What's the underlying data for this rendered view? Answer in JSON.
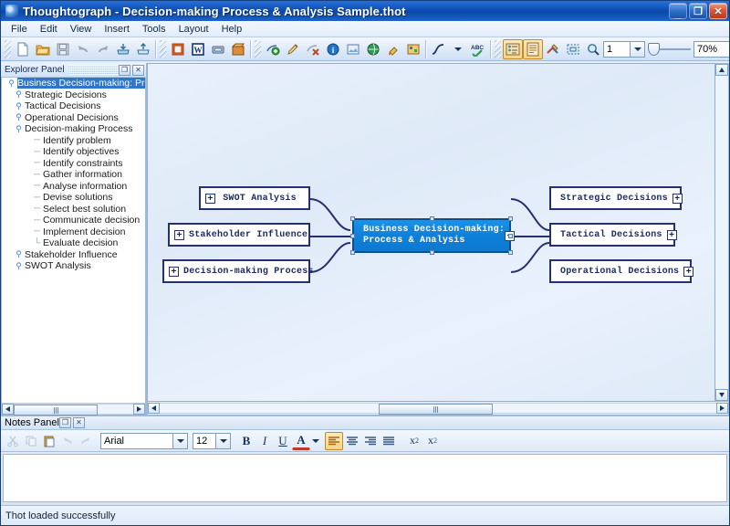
{
  "window": {
    "title": "Thoughtograph - Decision-making Process & Analysis Sample.thot",
    "app_icon": "thoughtograph-logo-icon",
    "minimize_label": "_",
    "maximize_label": "❐",
    "close_label": "✕"
  },
  "menu": {
    "items": [
      {
        "label": "File"
      },
      {
        "label": "Edit"
      },
      {
        "label": "View"
      },
      {
        "label": "Insert"
      },
      {
        "label": "Tools"
      },
      {
        "label": "Layout"
      },
      {
        "label": "Help"
      }
    ]
  },
  "toolbar": {
    "groups": [
      {
        "buttons": [
          {
            "name": "new-document-icon",
            "title": "New"
          },
          {
            "name": "open-folder-icon",
            "title": "Open"
          },
          {
            "name": "save-disk-icon",
            "title": "Save"
          },
          {
            "name": "undo-arrow-icon",
            "title": "Undo"
          },
          {
            "name": "redo-arrow-icon",
            "title": "Redo"
          },
          {
            "name": "import-tray-icon",
            "title": "Import"
          },
          {
            "name": "export-tray-icon",
            "title": "Export"
          }
        ]
      },
      {
        "buttons": [
          {
            "name": "export-powerpoint-icon",
            "title": "Export to PowerPoint"
          },
          {
            "name": "export-word-icon",
            "title": "Export to Word"
          },
          {
            "name": "export-html-icon",
            "title": "Export to HTML"
          },
          {
            "name": "export-package-icon",
            "title": "Export package"
          }
        ]
      },
      {
        "buttons": [
          {
            "name": "add-node-icon",
            "title": "Add node"
          },
          {
            "name": "edit-node-icon",
            "title": "Edit node"
          },
          {
            "name": "delete-node-icon",
            "title": "Delete node"
          },
          {
            "name": "node-info-icon",
            "title": "Node information"
          },
          {
            "name": "insert-image-icon",
            "title": "Insert image"
          },
          {
            "name": "insert-link-icon",
            "title": "Insert link"
          },
          {
            "name": "paint-fill-icon",
            "title": "Fill colour"
          },
          {
            "name": "node-properties-icon",
            "title": "Node properties"
          }
        ]
      },
      {
        "buttons": [
          {
            "name": "curve-style-icon",
            "title": "Connector style"
          },
          {
            "name": "curve-style-dropdown-icon",
            "title": "Connector style options"
          },
          {
            "name": "spell-check-icon",
            "title": "Spell check"
          }
        ]
      },
      {
        "buttons": [
          {
            "name": "explorer-panel-toggle-icon",
            "title": "Explorer Panel",
            "active": true
          },
          {
            "name": "notes-panel-toggle-icon",
            "title": "Notes Panel",
            "active": true
          },
          {
            "name": "tools-options-icon",
            "title": "Options"
          },
          {
            "name": "fit-to-window-icon",
            "title": "Fit to window"
          },
          {
            "name": "zoom-tool-icon",
            "title": "Zoom"
          }
        ]
      }
    ],
    "level_value": "1",
    "zoom_value": "70%",
    "pan_tool_icon": "hand-pan-icon"
  },
  "explorer": {
    "title": "Explorer Panel",
    "float_label": "❐",
    "close_label": "✕",
    "tree": [
      {
        "label": "Business Decision-making: Pro",
        "level": 0,
        "selected": true,
        "marker": "key"
      },
      {
        "label": "Strategic Decisions",
        "level": 1,
        "marker": "key"
      },
      {
        "label": "Tactical Decisions",
        "level": 1,
        "marker": "key"
      },
      {
        "label": "Operational Decisions",
        "level": 1,
        "marker": "key"
      },
      {
        "label": "Decision-making Process",
        "level": 1,
        "marker": "key"
      },
      {
        "label": "Identify problem",
        "level": 2,
        "marker": "dash"
      },
      {
        "label": "Identify objectives",
        "level": 2,
        "marker": "dash"
      },
      {
        "label": "Identify constraints",
        "level": 2,
        "marker": "dash"
      },
      {
        "label": "Gather information",
        "level": 2,
        "marker": "dash"
      },
      {
        "label": "Analyse information",
        "level": 2,
        "marker": "dash"
      },
      {
        "label": "Devise solutions",
        "level": 2,
        "marker": "dash"
      },
      {
        "label": "Select best solution",
        "level": 2,
        "marker": "dash"
      },
      {
        "label": "Communicate decision",
        "level": 2,
        "marker": "dash"
      },
      {
        "label": "Implement decision",
        "level": 2,
        "marker": "dash"
      },
      {
        "label": "Evaluate decision",
        "level": 2,
        "marker": "dash"
      },
      {
        "label": "Stakeholder Influence",
        "level": 1,
        "marker": "key"
      },
      {
        "label": "SWOT Analysis",
        "level": 1,
        "marker": "key"
      }
    ]
  },
  "canvas": {
    "center_node": {
      "line1": "Business Decision-making:",
      "line2": "Process & Analysis",
      "collapse_label": "−",
      "selected": true,
      "fill_color": "#0f80da",
      "text_color": "#ffffff"
    },
    "left_nodes": [
      {
        "label": "SWOT Analysis",
        "expand_label": "+"
      },
      {
        "label": "Stakeholder Influence",
        "expand_label": "+"
      },
      {
        "label": "Decision-making Process",
        "expand_label": "+"
      }
    ],
    "right_nodes": [
      {
        "label": "Strategic Decisions",
        "expand_label": "+"
      },
      {
        "label": "Tactical Decisions",
        "expand_label": "+"
      },
      {
        "label": "Operational Decisions",
        "expand_label": "+"
      }
    ],
    "node_border_color": "#26306e",
    "connector_color": "#26306e"
  },
  "notes": {
    "title": "Notes Panel",
    "float_label": "❐",
    "close_label": "✕",
    "font_name": "Arial",
    "font_size": "12",
    "content": "",
    "buttons": {
      "cut": "cut-icon",
      "copy": "copy-icon",
      "paste": "paste-icon",
      "undo": "undo-icon",
      "redo": "redo-icon",
      "bold": "B",
      "italic": "I",
      "underline": "U",
      "font_color": "A",
      "font_color_arrow": "▾",
      "align_left": "align-left-icon",
      "align_center": "align-center-icon",
      "align_right": "align-right-icon",
      "align_justify": "align-justify-icon",
      "superscript_base": "x",
      "superscript_exp": "2",
      "subscript_base": "x",
      "subscript_exp": "2"
    }
  },
  "status": {
    "message": "Thot loaded successfully"
  }
}
